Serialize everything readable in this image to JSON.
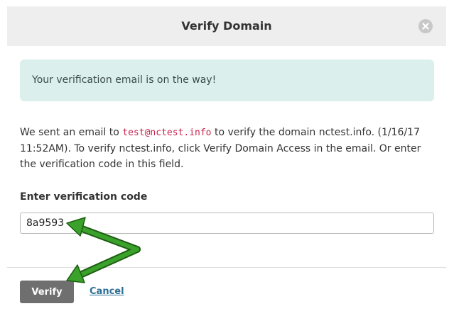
{
  "dialog": {
    "title": "Verify Domain",
    "close_icon": "close-icon"
  },
  "alert": {
    "message": "Your verification email is on the way!",
    "background_color": "#dbf0ec"
  },
  "description": {
    "prefix": "We sent an email to ",
    "email": "test@nctest.info",
    "suffix": " to verify the domain nctest.info. (1/16/17 11:52AM). To verify nctest.info, click Verify Domain Access in the email. Or enter the verification code in this field."
  },
  "form": {
    "code_label": "Enter verification code",
    "code_value": "8a9593"
  },
  "actions": {
    "verify_label": "Verify",
    "cancel_label": "Cancel"
  },
  "annotation": {
    "arrow_color": "#2e8b1e",
    "arrow_icon": "green-arrow-icon"
  }
}
